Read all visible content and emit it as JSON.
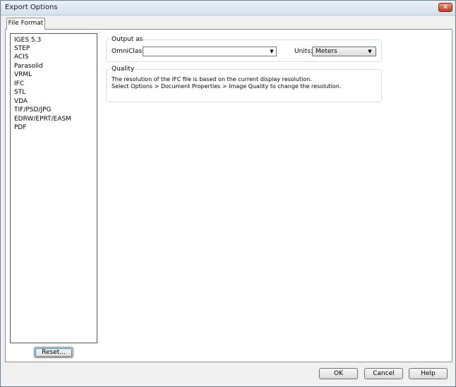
{
  "window": {
    "title": "Export Options",
    "close_glyph": "✕"
  },
  "tabs": [
    {
      "label": "File Format"
    }
  ],
  "format_list": {
    "items": [
      "IGES 5.3",
      "STEP",
      "ACIS",
      "Parasolid",
      "VRML",
      "IFC",
      "STL",
      "VDA",
      "TIF/PSD/JPG",
      "EDRW/EPRT/EASM",
      "PDF"
    ],
    "selected": "IFC"
  },
  "reset_button": {
    "label": "Reset..."
  },
  "output_as": {
    "legend": "Output as",
    "omniclass_label": "OmniClass:",
    "omniclass_value": "",
    "units_label": "Units:",
    "units_value": "Meters"
  },
  "quality": {
    "legend": "Quality",
    "line1": "The resolution of the IFC file is based on the current display resolution.",
    "line2": "Select Options > Document Properties > Image Quality to change the resolution."
  },
  "buttons": {
    "ok": "OK",
    "cancel": "Cancel",
    "help": "Help"
  },
  "icons": {
    "dropdown": "chevron-down-icon",
    "close": "close-icon"
  }
}
